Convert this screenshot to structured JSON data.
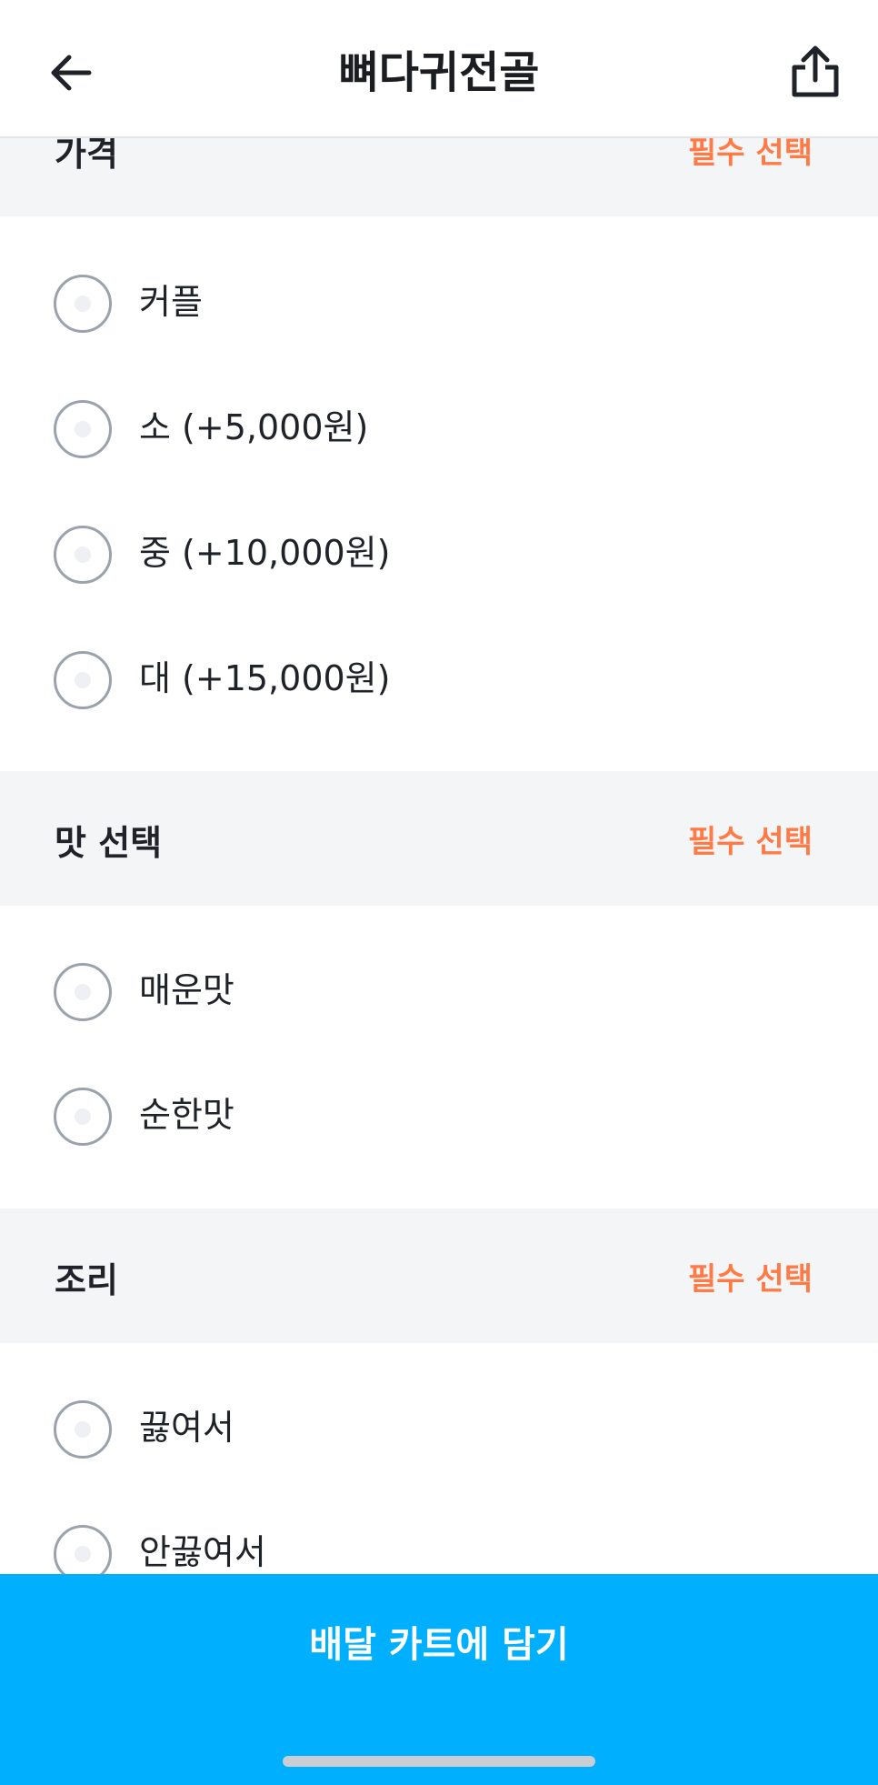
{
  "header": {
    "title": "뼈다귀전골",
    "back_icon": "arrow-left-icon",
    "share_icon": "share-icon"
  },
  "colors": {
    "accent": "#00b0ff",
    "required": "#ff7a45",
    "section_bg": "#f4f5f7"
  },
  "sections": [
    {
      "label": "가격",
      "required": "필수 선택",
      "options": [
        "커플",
        "소 (+5,000원)",
        "중 (+10,000원)",
        "대 (+15,000원)"
      ]
    },
    {
      "label": "맛 선택",
      "required": "필수 선택",
      "options": [
        "매운맛",
        "순한맛"
      ]
    },
    {
      "label": "조리",
      "required": "필수 선택",
      "options": [
        "끓여서",
        "안끓여서"
      ]
    }
  ],
  "cta": {
    "label": "배달 카트에 담기"
  }
}
